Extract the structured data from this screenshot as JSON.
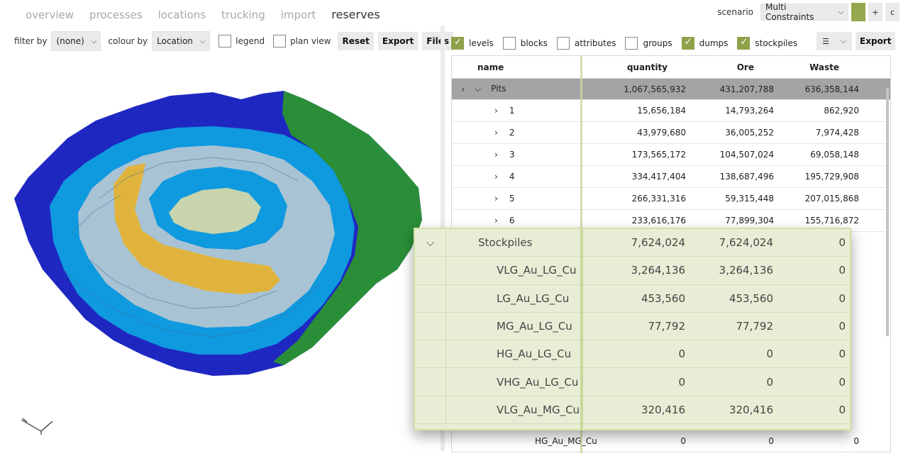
{
  "nav": {
    "tabs": [
      "overview",
      "processes",
      "locations",
      "trucking",
      "import",
      "reserves"
    ]
  },
  "scenario": {
    "label": "scenario",
    "value": "Multi Constraints",
    "plus": "+",
    "c": "c"
  },
  "left_toolbar": {
    "filter_label": "filter by",
    "filter_value": "(none)",
    "colour_label": "colour by",
    "colour_value": "Location",
    "legend_label": "legend",
    "plan_view_label": "plan view",
    "reset": "Reset",
    "export": "Export",
    "files": "Files"
  },
  "right_toolbar": {
    "levels": "levels",
    "blocks": "blocks",
    "attributes": "attributes",
    "groups": "groups",
    "dumps": "dumps",
    "stockpiles": "stockpiles",
    "export": "Export"
  },
  "table": {
    "headers": {
      "name": "name",
      "quantity": "quantity",
      "ore": "Ore",
      "waste": "Waste"
    },
    "pits": {
      "name": "Pits",
      "quantity": "1,067,565,932",
      "ore": "431,207,788",
      "waste": "636,358,144"
    },
    "rows": [
      {
        "name": "1",
        "quantity": "15,656,184",
        "ore": "14,793,264",
        "waste": "862,920"
      },
      {
        "name": "2",
        "quantity": "43,979,680",
        "ore": "36,005,252",
        "waste": "7,974,428"
      },
      {
        "name": "3",
        "quantity": "173,565,172",
        "ore": "104,507,024",
        "waste": "69,058,148"
      },
      {
        "name": "4",
        "quantity": "334,417,404",
        "ore": "138,687,496",
        "waste": "195,729,908"
      },
      {
        "name": "5",
        "quantity": "266,331,316",
        "ore": "59,315,448",
        "waste": "207,015,868"
      },
      {
        "name": "6",
        "quantity": "233,616,176",
        "ore": "77,899,304",
        "waste": "155,716,872"
      }
    ],
    "bottom_row": {
      "name": "HG_Au_MG_Cu",
      "quantity": "0",
      "ore": "0",
      "waste": "0"
    }
  },
  "zoom": {
    "header": {
      "name": "Stockpiles",
      "quantity": "7,624,024",
      "ore": "7,624,024",
      "waste": "0"
    },
    "rows": [
      {
        "name": "VLG_Au_LG_Cu",
        "quantity": "3,264,136",
        "ore": "3,264,136",
        "waste": "0"
      },
      {
        "name": "LG_Au_LG_Cu",
        "quantity": "453,560",
        "ore": "453,560",
        "waste": "0"
      },
      {
        "name": "MG_Au_LG_Cu",
        "quantity": "77,792",
        "ore": "77,792",
        "waste": "0"
      },
      {
        "name": "HG_Au_LG_Cu",
        "quantity": "0",
        "ore": "0",
        "waste": "0"
      },
      {
        "name": "VHG_Au_LG_Cu",
        "quantity": "0",
        "ore": "0",
        "waste": "0"
      },
      {
        "name": "VLG_Au_MG_Cu",
        "quantity": "320,416",
        "ore": "320,416",
        "waste": "0"
      }
    ]
  },
  "colors": {
    "dark_blue": "#1f27c1",
    "mid_blue": "#0f99df",
    "light_blue": "#a8c3d4",
    "gold": "#e0b43c",
    "green": "#2a8e38",
    "pale": "#c7d4ad",
    "accent": "#8ea24a"
  }
}
